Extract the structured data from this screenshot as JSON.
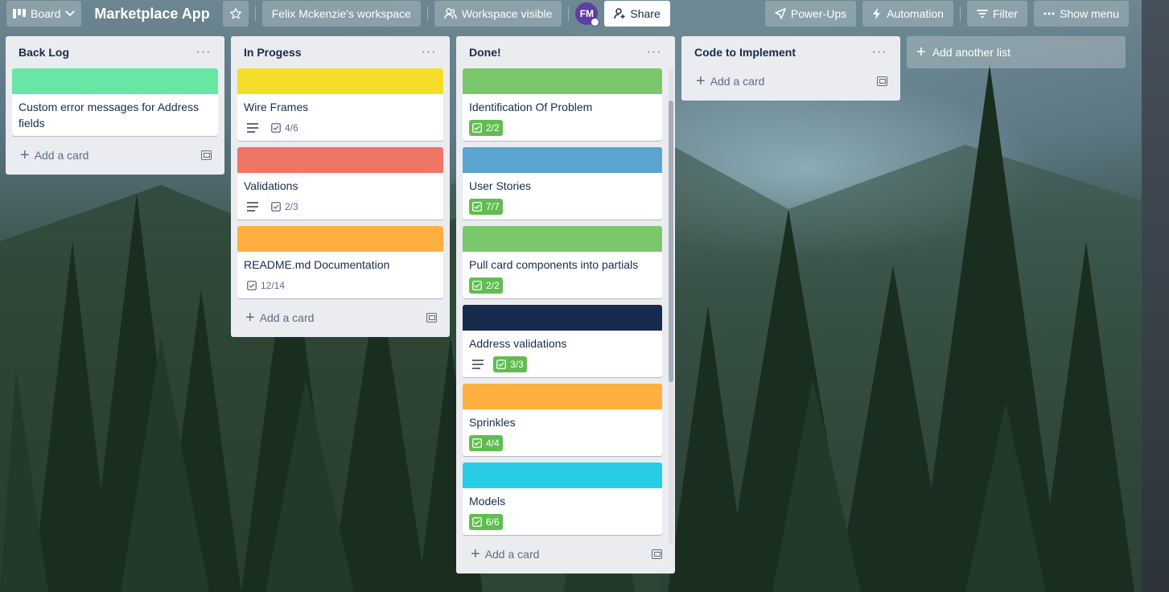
{
  "header": {
    "board_switcher_label": "Board",
    "board_title": "Marketplace App",
    "workspace_label": "Felix Mckenzie's workspace",
    "visibility_label": "Workspace visible",
    "avatar_initials": "FM",
    "share_label": "Share",
    "power_ups_label": "Power-Ups",
    "automation_label": "Automation",
    "filter_label": "Filter",
    "show_menu_label": "Show menu"
  },
  "lists": [
    {
      "title": "Back Log",
      "add_card_label": "Add a card",
      "cards": [
        {
          "title": "Custom error messages for Address fields",
          "cover": "#67e6a6"
        }
      ]
    },
    {
      "title": "In Progess",
      "add_card_label": "Add a card",
      "cards": [
        {
          "title": "Wire Frames",
          "cover": "#f5dd29",
          "checklist": "4/6"
        },
        {
          "title": "Validations",
          "cover": "#ef7564",
          "checklist": "2/3"
        },
        {
          "title": "README.md Documentation",
          "cover": "#ffaf3f",
          "checklist": "12/14"
        }
      ]
    },
    {
      "title": "Done!",
      "add_card_label": "Add a card",
      "cards": [
        {
          "title": "Identification Of Problem",
          "cover": "#7bc86c",
          "checklist": "2/2"
        },
        {
          "title": "User Stories",
          "cover": "#5ba4cf",
          "checklist": "7/7"
        },
        {
          "title": "Pull card components into partials",
          "cover": "#7bc86c",
          "checklist": "2/2"
        },
        {
          "title": "Address validations",
          "cover": "#172b4d",
          "checklist": "3/3"
        },
        {
          "title": "Sprinkles",
          "cover": "#ffaf3f",
          "checklist": "4/4"
        },
        {
          "title": "Models",
          "cover": "#29cce5",
          "checklist": "6/6"
        }
      ]
    },
    {
      "title": "Code to Implement",
      "add_card_label": "Add a card",
      "cards": []
    }
  ],
  "add_list_label": "Add another list",
  "icons": [
    "board-icon",
    "chevron-down-icon",
    "star-icon",
    "people-icon",
    "share-person-icon",
    "rocket-icon",
    "bolt-icon",
    "filter-icon",
    "dots-icon",
    "description-icon",
    "checklist-icon",
    "plus-icon",
    "template-icon"
  ]
}
